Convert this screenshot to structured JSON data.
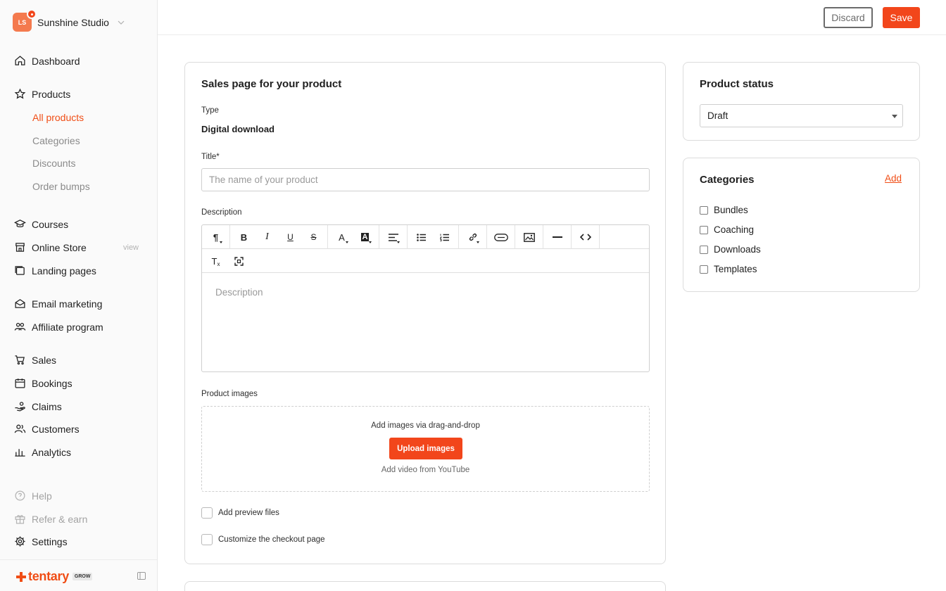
{
  "store": {
    "initials": "LS",
    "name": "Sunshine Studio"
  },
  "sidebar": {
    "dashboard": "Dashboard",
    "products": "Products",
    "products_sub": [
      "All products",
      "Categories",
      "Discounts",
      "Order bumps"
    ],
    "courses": "Courses",
    "online_store": "Online Store",
    "online_store_view": "view",
    "landing_pages": "Landing pages",
    "email_marketing": "Email marketing",
    "affiliate_program": "Affiliate program",
    "sales": "Sales",
    "bookings": "Bookings",
    "claims": "Claims",
    "customers": "Customers",
    "analytics": "Analytics",
    "help": "Help",
    "refer": "Refer & earn",
    "settings": "Settings"
  },
  "brand": {
    "name": "tentary",
    "tag": "GROW",
    "color": "#f04d15"
  },
  "topbar": {
    "discard_label": "Discard",
    "save_label": "Save"
  },
  "sales_page": {
    "title": "Sales page for your product",
    "type_label": "Type",
    "type_value": "Digital download",
    "title_label": "Title*",
    "title_value": "",
    "title_placeholder": "The name of your product",
    "description_label": "Description",
    "description_placeholder": "Description",
    "editor_toolbar": {
      "paragraph": "¶",
      "bold": "B",
      "italic": "I",
      "underline": "U",
      "strike": "S",
      "font_color": "A",
      "highlight": "A",
      "clear_format": "T"
    },
    "images_label": "Product images",
    "dropzone_text": "Add images via drag-and-drop",
    "upload_button": "Upload images",
    "youtube_link": "Add video from YouTube",
    "preview_files": "Add preview files",
    "customize_checkout": "Customize the checkout page"
  },
  "product_status": {
    "title": "Product status",
    "selected": "Draft"
  },
  "categories": {
    "title": "Categories",
    "add_label": "Add",
    "items": [
      "Bundles",
      "Coaching",
      "Downloads",
      "Templates"
    ]
  },
  "colors": {
    "accent": "#f2461b",
    "active_nav": "#f04d15"
  }
}
